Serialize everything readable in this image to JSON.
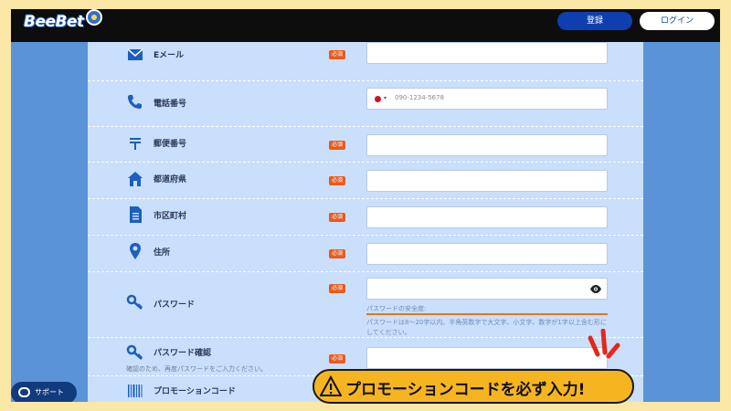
{
  "header": {
    "logo_text": "BeeBet",
    "register_label": "登録",
    "login_label": "ログイン"
  },
  "form": {
    "email_label": "Eメール",
    "phone_label": "電話番号",
    "phone_placeholder": "090-1234-5678",
    "postal_label": "郵便番号",
    "prefecture_label": "都道府県",
    "city_label": "市区町村",
    "address_label": "住所",
    "password_label": "パスワード",
    "password_strength_label": "パスワードの安全度:",
    "password_hint": "パスワードは8〜20字以内。半角英数字で大文字、小文字、数字が1字以上含む形にしてください。",
    "password_confirm_label": "パスワード確認",
    "password_confirm_hint": "確認のため、再度パスワードをご入力ください。",
    "promo_label": "プロモーションコード",
    "required_badge": "必須"
  },
  "support": {
    "label": "サポート"
  },
  "promo_banner": {
    "text": "プロモーションコードを必ず入力!"
  },
  "colors": {
    "accent_orange": "#e85a1e",
    "header_blue": "#0f3fae",
    "banner_yellow": "#f6b520"
  },
  "icons": [
    "mail-icon",
    "phone-icon",
    "postal-icon",
    "home-icon",
    "document-icon",
    "location-pin-icon",
    "key-icon",
    "key-icon",
    "barcode-icon",
    "eye-icon",
    "chat-icon",
    "warning-icon"
  ]
}
